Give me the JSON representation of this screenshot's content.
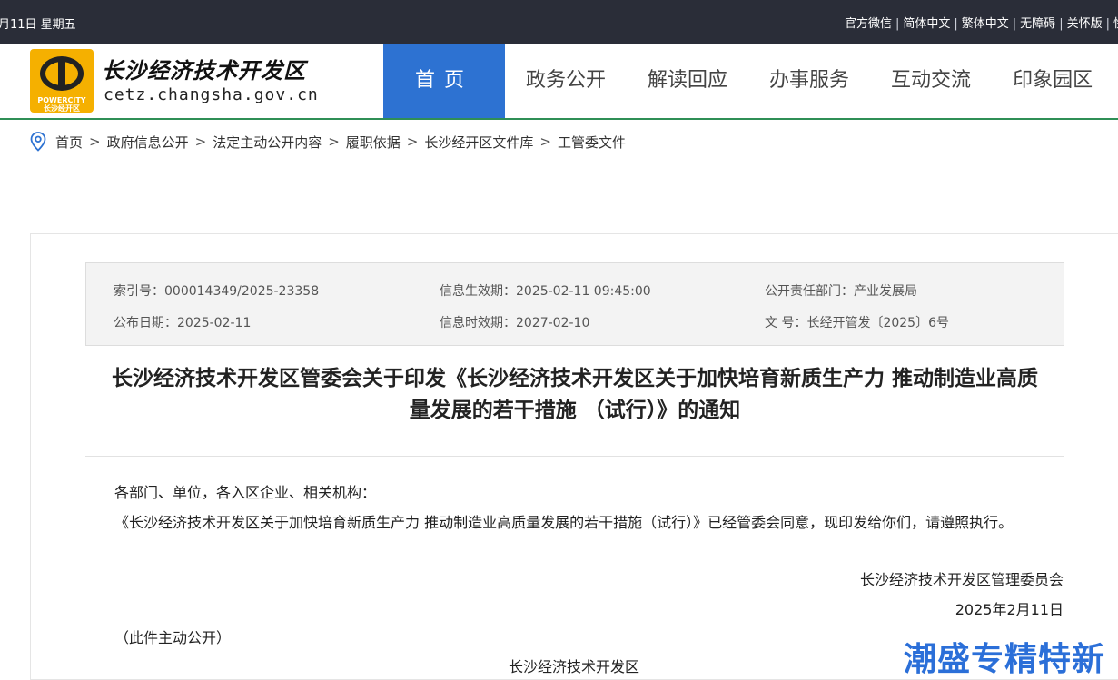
{
  "topbar": {
    "date": "月11日 星期五",
    "links": [
      "官方微信",
      "简体中文",
      "繁体中文",
      "无障碍",
      "关怀版",
      "快"
    ]
  },
  "header": {
    "logo_text_en": "POWERCITY",
    "logo_text_cn": "长沙经开区",
    "site_name": "长沙经济技术开发区",
    "site_url": "cetz.changsha.gov.cn"
  },
  "nav": {
    "items": [
      {
        "label": "首页"
      },
      {
        "label": "政务公开"
      },
      {
        "label": "解读回应"
      },
      {
        "label": "办事服务"
      },
      {
        "label": "互动交流"
      },
      {
        "label": "印象园区"
      }
    ],
    "active_index": 0
  },
  "breadcrumb": {
    "icon": "location-pin-icon",
    "items": [
      "首页",
      "政府信息公开",
      "法定主动公开内容",
      "履职依据",
      "长沙经开区文件库",
      "工管委文件"
    ],
    "separator": ">"
  },
  "meta": {
    "index_no": "索引号：000014349/2025-23358",
    "effective_date": "信息生效期：2025-02-11 09:45:00",
    "dept": "公开责任部门：产业发展局",
    "publish_date": "公布日期：2025-02-11",
    "expiry_date": "信息时效期：2027-02-10",
    "doc_no": "文 号：长经开管发〔2025〕6号"
  },
  "article": {
    "title_line1": "长沙经济技术开发区管委会关于印发《长沙经济技术开发区关于加快培育新质生产力 推动制造业高质",
    "title_line2": "量发展的若干措施 （试行）》的通知",
    "salutation": "各部门、单位，各入区企业、相关机构：",
    "paragraph1": "《长沙经济技术开发区关于加快培育新质生产力 推动制造业高质量发展的若干措施（试行）》已经管委会同意，现印发给你们，请遵照执行。",
    "signer": "长沙经济技术开发区管理委员会",
    "sign_date": "2025年2月11日",
    "disclosure": "（此件主动公开）",
    "next_heading": "长沙经济技术开发区"
  },
  "watermark": "潮盛专精特新",
  "colors": {
    "topbar_bg": "#2a2d38",
    "nav_active_bg": "#2d72d2",
    "header_border": "#2f8f56",
    "logo_bg": "#f5b000",
    "watermark": "#2b6fd8"
  }
}
